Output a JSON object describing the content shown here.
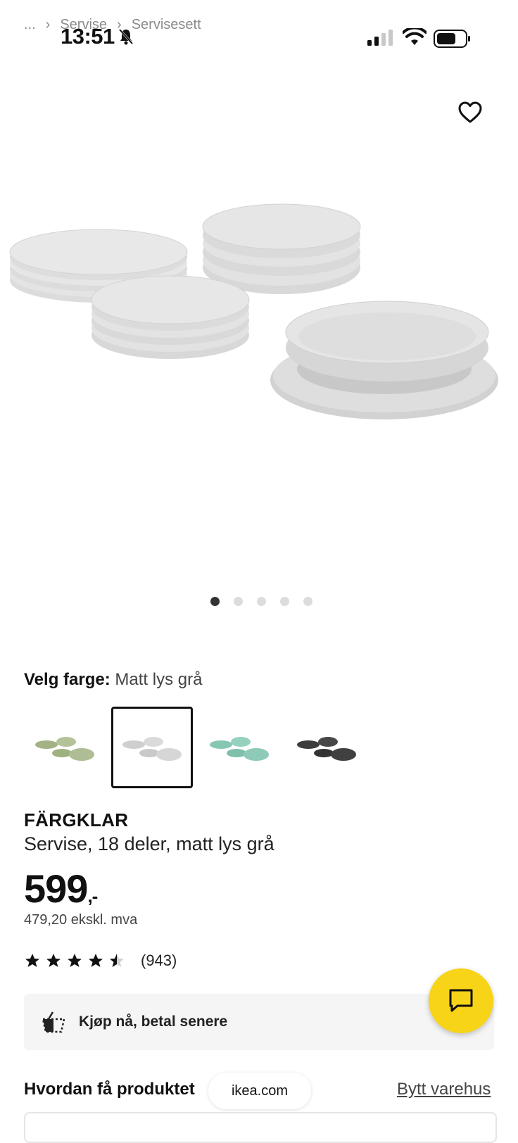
{
  "status": {
    "time": "13:51"
  },
  "breadcrumb": [
    "...",
    "Servise",
    "Servisesett"
  ],
  "gallery": {
    "dot_count": 5,
    "active_index": 0
  },
  "color": {
    "label": "Velg farge:",
    "value": "Matt lys grå"
  },
  "swatches": [
    {
      "name": "green",
      "color": "#a9b98e",
      "selected": false
    },
    {
      "name": "light-grey",
      "color": "#d9d9d9",
      "selected": true
    },
    {
      "name": "turquoise",
      "color": "#8ccbb8",
      "selected": false
    },
    {
      "name": "dark-grey",
      "color": "#3a3a3a",
      "selected": false
    }
  ],
  "product": {
    "brand": "FÄRGKLAR",
    "description": "Servise, 18 deler, matt lys grå",
    "price": "599",
    "price_suffix": ",-",
    "price_ex_vat": "479,20 ekskl. mva"
  },
  "rating": {
    "stars": 4.5,
    "count": "(943)"
  },
  "bnpl": {
    "label": "Kjøp nå, betal senere"
  },
  "fulfilment": {
    "title": "Hvordan få produktet",
    "change_store": "Bytt varehus"
  },
  "browser": {
    "url": "ikea.com"
  },
  "colors": {
    "chat": "#f7d417",
    "text": "#111111"
  },
  "icons": {
    "favorite": "heart-icon",
    "chat": "chat-icon",
    "bnpl": "basket-icon"
  }
}
